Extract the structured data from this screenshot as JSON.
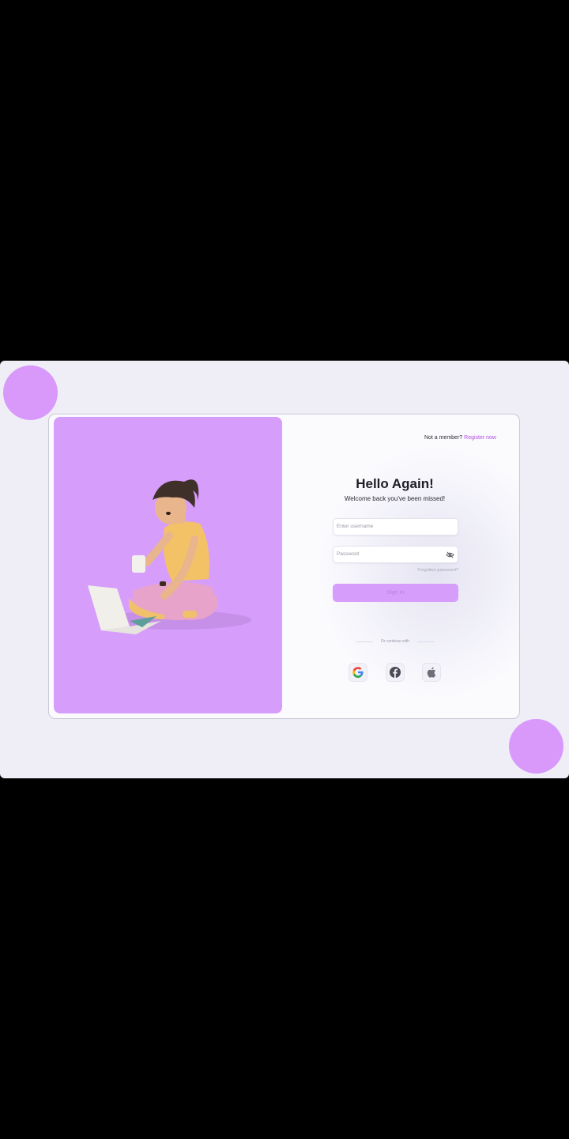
{
  "auth": {
    "register_prompt": "Not a member?",
    "register_link": "Register now",
    "title": "Hello Again!",
    "subtitle": "Welcome back you've been missed!",
    "username_placeholder": "Enter username",
    "password_placeholder": "Password",
    "forgot_password": "Forgotten password?",
    "sign_in": "Sign In",
    "continue_with": "Or continue with"
  },
  "social": [
    "google-icon",
    "facebook-icon",
    "apple-icon"
  ],
  "colors": {
    "accent": "#d79dfb",
    "link": "#b04ce0",
    "background": "#efeef7",
    "card": "#fbfbfe"
  }
}
